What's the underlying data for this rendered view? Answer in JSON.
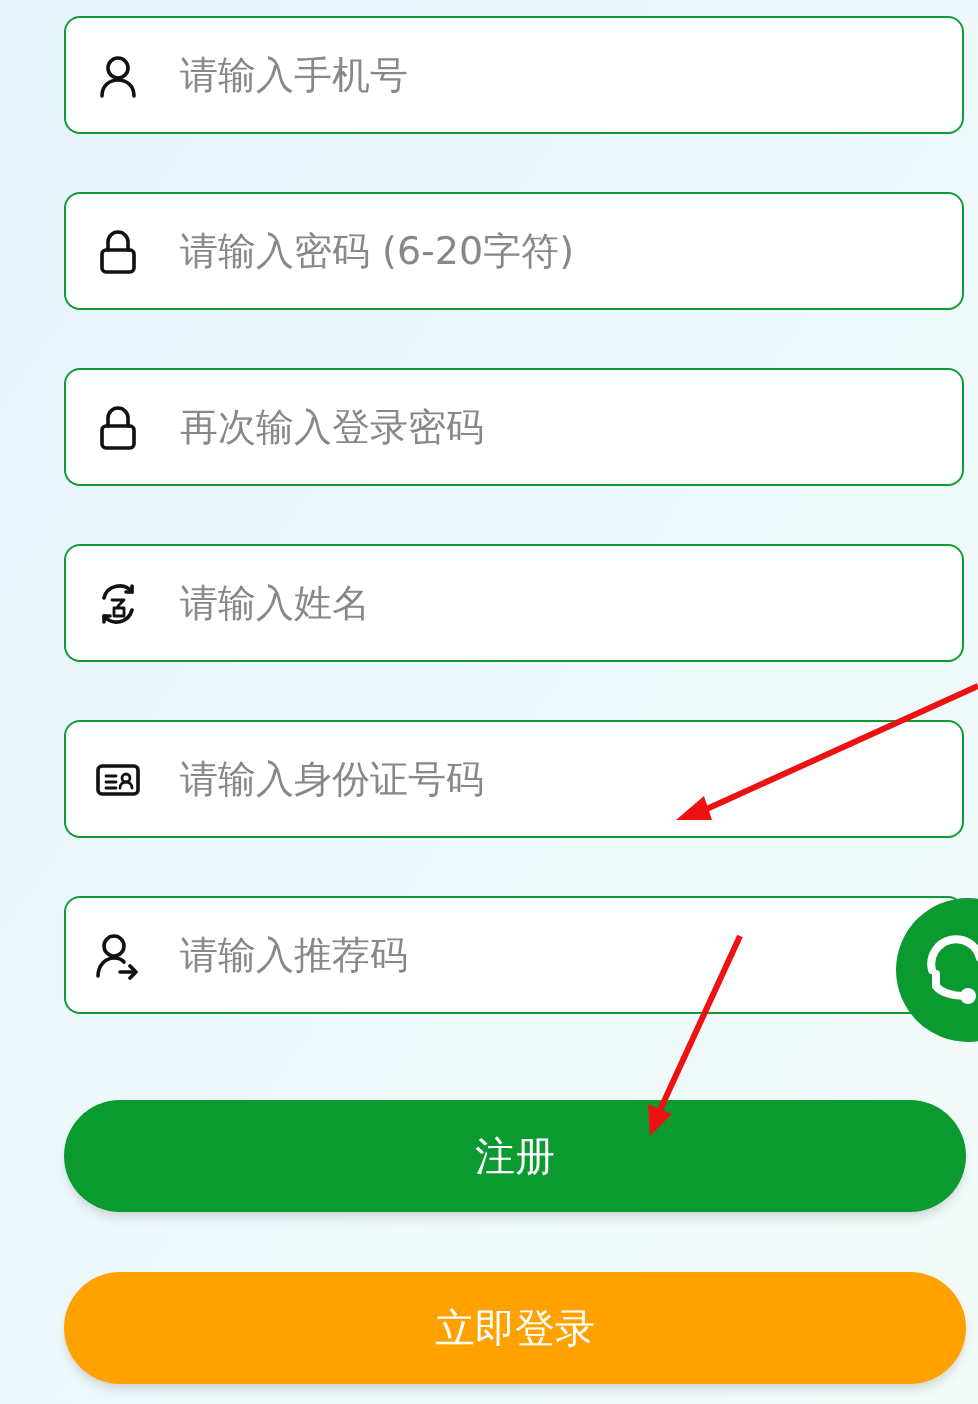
{
  "fields": [
    {
      "kind": "phone",
      "placeholder": "请输入手机号"
    },
    {
      "kind": "password",
      "placeholder": "请输入密码 (6-20字符)"
    },
    {
      "kind": "password",
      "placeholder": "再次输入登录密码"
    },
    {
      "kind": "name",
      "placeholder": "请输入姓名"
    },
    {
      "kind": "id",
      "placeholder": "请输入身份证号码"
    },
    {
      "kind": "referrer",
      "placeholder": "请输入推荐码"
    }
  ],
  "register_button": "注册",
  "login_button": "立即登录"
}
